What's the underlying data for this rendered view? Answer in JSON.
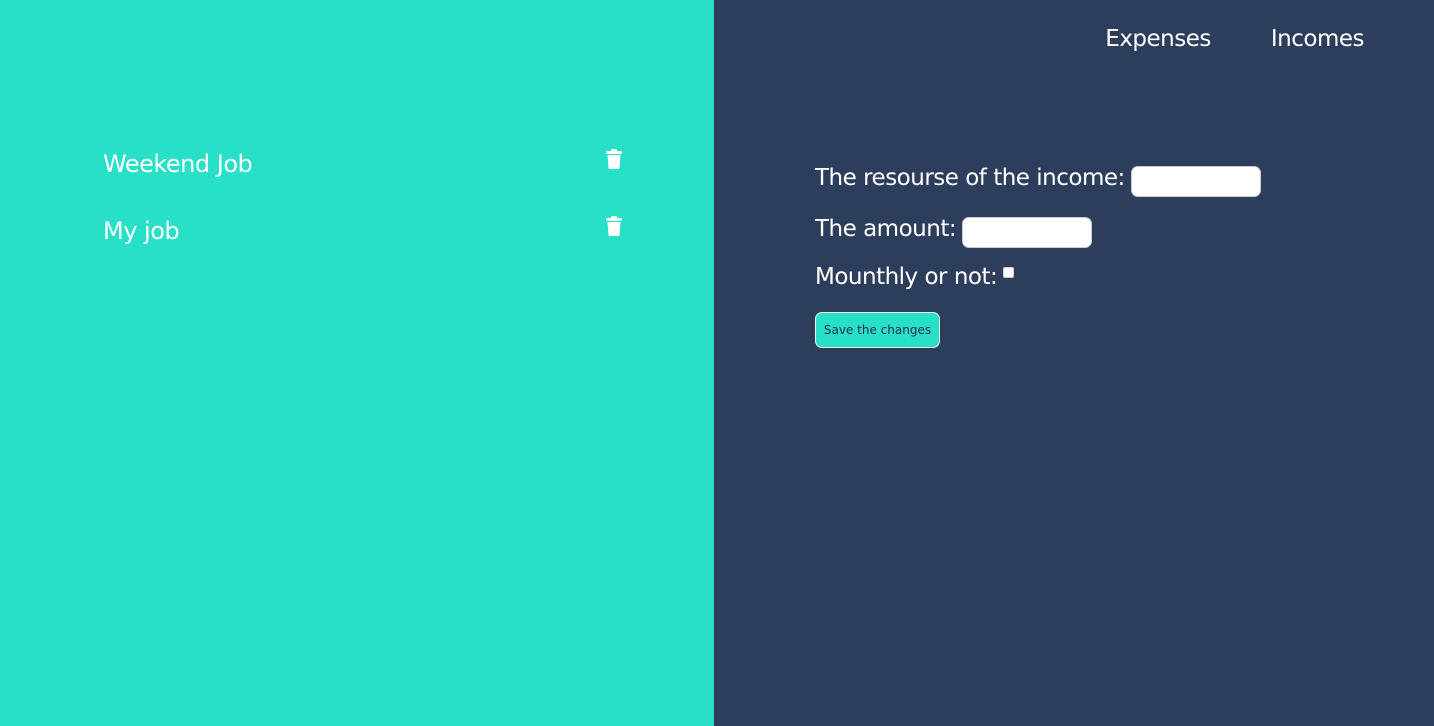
{
  "nav": {
    "expenses_label": "Expenses",
    "incomes_label": "Incomes"
  },
  "incomes": {
    "items": [
      {
        "label": "Weekend Job",
        "icon": "trash-icon"
      },
      {
        "label": "My job",
        "icon": "trash-icon"
      }
    ]
  },
  "form": {
    "source_label": "The resourse of the income:",
    "source_value": "",
    "amount_label": "The amount:",
    "amount_value": "",
    "monthly_label": "Mounthly or not:",
    "monthly_checked": false,
    "save_label": "Save the changes"
  },
  "colors": {
    "left_panel": "#28dfc8",
    "right_panel": "#2c3e5c",
    "text": "#ffffff",
    "button_text": "#1e2f47"
  }
}
